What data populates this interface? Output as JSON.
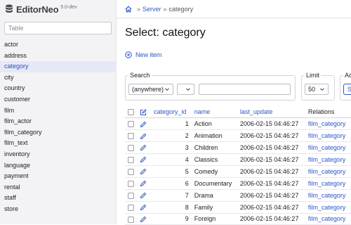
{
  "app": {
    "name": "EditorNeo",
    "version": "5.0-dev"
  },
  "sidebar": {
    "search_placeholder": "Table",
    "tables": [
      "actor",
      "address",
      "category",
      "city",
      "country",
      "customer",
      "film",
      "film_actor",
      "film_category",
      "film_text",
      "inventory",
      "language",
      "payment",
      "rental",
      "staff",
      "store"
    ],
    "active": "category"
  },
  "breadcrumb": {
    "sep": "»",
    "server": "Server",
    "current": "category"
  },
  "page": {
    "title": "Select: category",
    "new_item": "New item"
  },
  "search": {
    "legend": "Search",
    "scope": "(anywhere)",
    "operator": "",
    "value": "",
    "limit_legend": "Limit",
    "limit": "50",
    "action_legend": "Act",
    "action_button": "S"
  },
  "table": {
    "columns": [
      "category_id",
      "name",
      "last_update",
      "Relations"
    ],
    "rows": [
      {
        "id": "1",
        "name": "Action",
        "last_update": "2006-02-15 04:46:27",
        "relation": "film_category"
      },
      {
        "id": "2",
        "name": "Animation",
        "last_update": "2006-02-15 04:46:27",
        "relation": "film_category"
      },
      {
        "id": "3",
        "name": "Children",
        "last_update": "2006-02-15 04:46:27",
        "relation": "film_category"
      },
      {
        "id": "4",
        "name": "Classics",
        "last_update": "2006-02-15 04:46:27",
        "relation": "film_category"
      },
      {
        "id": "5",
        "name": "Comedy",
        "last_update": "2006-02-15 04:46:27",
        "relation": "film_category"
      },
      {
        "id": "6",
        "name": "Documentary",
        "last_update": "2006-02-15 04:46:27",
        "relation": "film_category"
      },
      {
        "id": "7",
        "name": "Drama",
        "last_update": "2006-02-15 04:46:27",
        "relation": "film_category"
      },
      {
        "id": "8",
        "name": "Family",
        "last_update": "2006-02-15 04:46:27",
        "relation": "film_category"
      },
      {
        "id": "9",
        "name": "Foreign",
        "last_update": "2006-02-15 04:46:27",
        "relation": "film_category"
      }
    ]
  },
  "icons": {
    "logo": "database-icon",
    "home": "home-icon",
    "new": "plus-circle-icon",
    "edit": "pencil-icon",
    "edit_all": "edit-square-icon",
    "dropdown": "chevron-down-icon"
  },
  "colors": {
    "accent": "#2b56c6",
    "sidebar_bg": "#f3f3f5",
    "active_bg": "#e6e9f5"
  }
}
